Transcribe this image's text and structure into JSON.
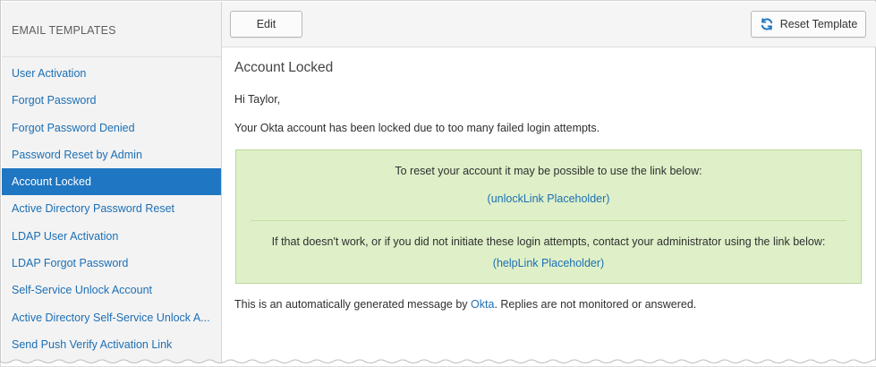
{
  "sidebar": {
    "header": "EMAIL TEMPLATES",
    "items": [
      {
        "label": "User Activation",
        "active": false
      },
      {
        "label": "Forgot Password",
        "active": false
      },
      {
        "label": "Forgot Password Denied",
        "active": false
      },
      {
        "label": "Password Reset by Admin",
        "active": false
      },
      {
        "label": "Account Locked",
        "active": true
      },
      {
        "label": "Active Directory Password Reset",
        "active": false
      },
      {
        "label": "LDAP User Activation",
        "active": false
      },
      {
        "label": "LDAP Forgot Password",
        "active": false
      },
      {
        "label": "Self-Service Unlock Account",
        "active": false
      },
      {
        "label": "Active Directory Self-Service Unlock A...",
        "active": false
      },
      {
        "label": "Send Push Verify Activation Link",
        "active": false
      }
    ]
  },
  "toolbar": {
    "edit_label": "Edit",
    "reset_label": "Reset Template",
    "reset_icon": "refresh-icon"
  },
  "email": {
    "title": "Account Locked",
    "greeting": "Hi Taylor,",
    "body": "Your Okta account has been locked due to too many failed login attempts.",
    "callout": {
      "line1": "To reset your account it may be possible to use the link below:",
      "link1": "(unlockLink Placeholder)",
      "line2": "If that doesn't work, or if you did not initiate these login attempts, contact your administrator using the link below:",
      "link2": "(helpLink Placeholder)"
    },
    "footer_before": "This is an automatically generated message by ",
    "footer_link": "Okta",
    "footer_after": ". Replies are not monitored or answered."
  },
  "colors": {
    "accent": "#1f76c2",
    "link": "#1c6fb5",
    "callout_bg": "#dff0c8",
    "callout_border": "#b8d89a",
    "sidebar_bg": "#f3f3f3"
  }
}
